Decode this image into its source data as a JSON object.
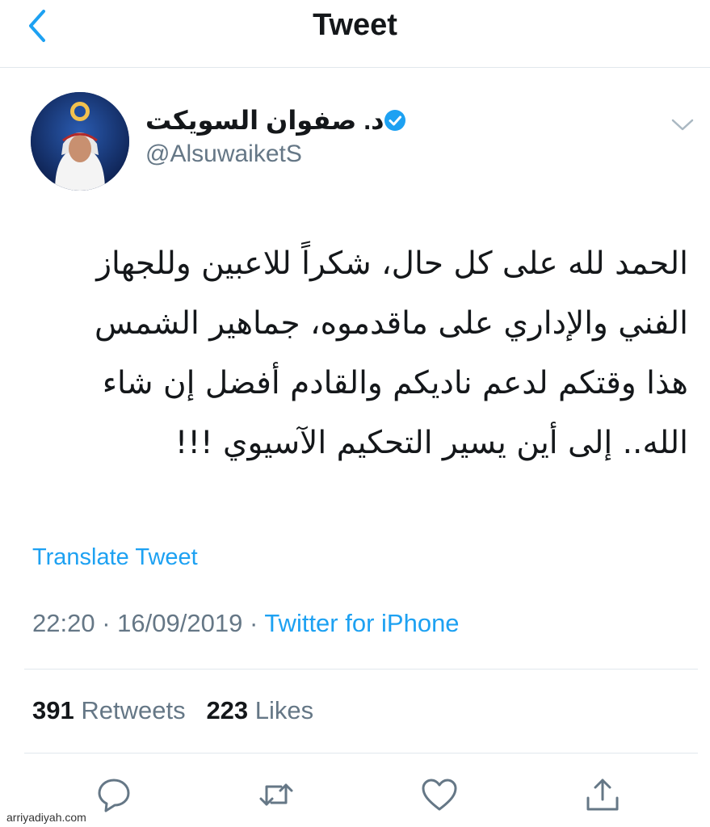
{
  "header": {
    "title": "Tweet"
  },
  "author": {
    "name": "د. صفوان السويكت",
    "handle": "@AlsuwaiketS"
  },
  "tweet": {
    "lines": [
      "الحمد لله على كل حال، شكراً للاعبين وللجهاز",
      "الفني والإداري على ماقدموه، جماهير الشمس",
      "هذا وقتكم لدعم ناديكم والقادم أفضل إن شاء",
      "الله.. إلى أين يسير التحكيم الآسيوي !!!"
    ]
  },
  "translate_label": "Translate Tweet",
  "meta": {
    "time": "22:20",
    "separator": "·",
    "date": "16/09/2019",
    "source": "Twitter for iPhone"
  },
  "stats": {
    "retweets_count": "391",
    "retweets_label": "Retweets",
    "likes_count": "223",
    "likes_label": "Likes"
  },
  "watermark": "arriyadiyah.com",
  "colors": {
    "accent": "#1da1f2",
    "secondary_text": "#657786",
    "divider": "#e1e8ed"
  },
  "icons": {
    "back": "chevron-left-icon",
    "verified": "verified-badge-icon",
    "more": "chevron-down-icon",
    "actions": [
      "reply-icon",
      "retweet-icon",
      "like-icon",
      "share-icon"
    ]
  }
}
